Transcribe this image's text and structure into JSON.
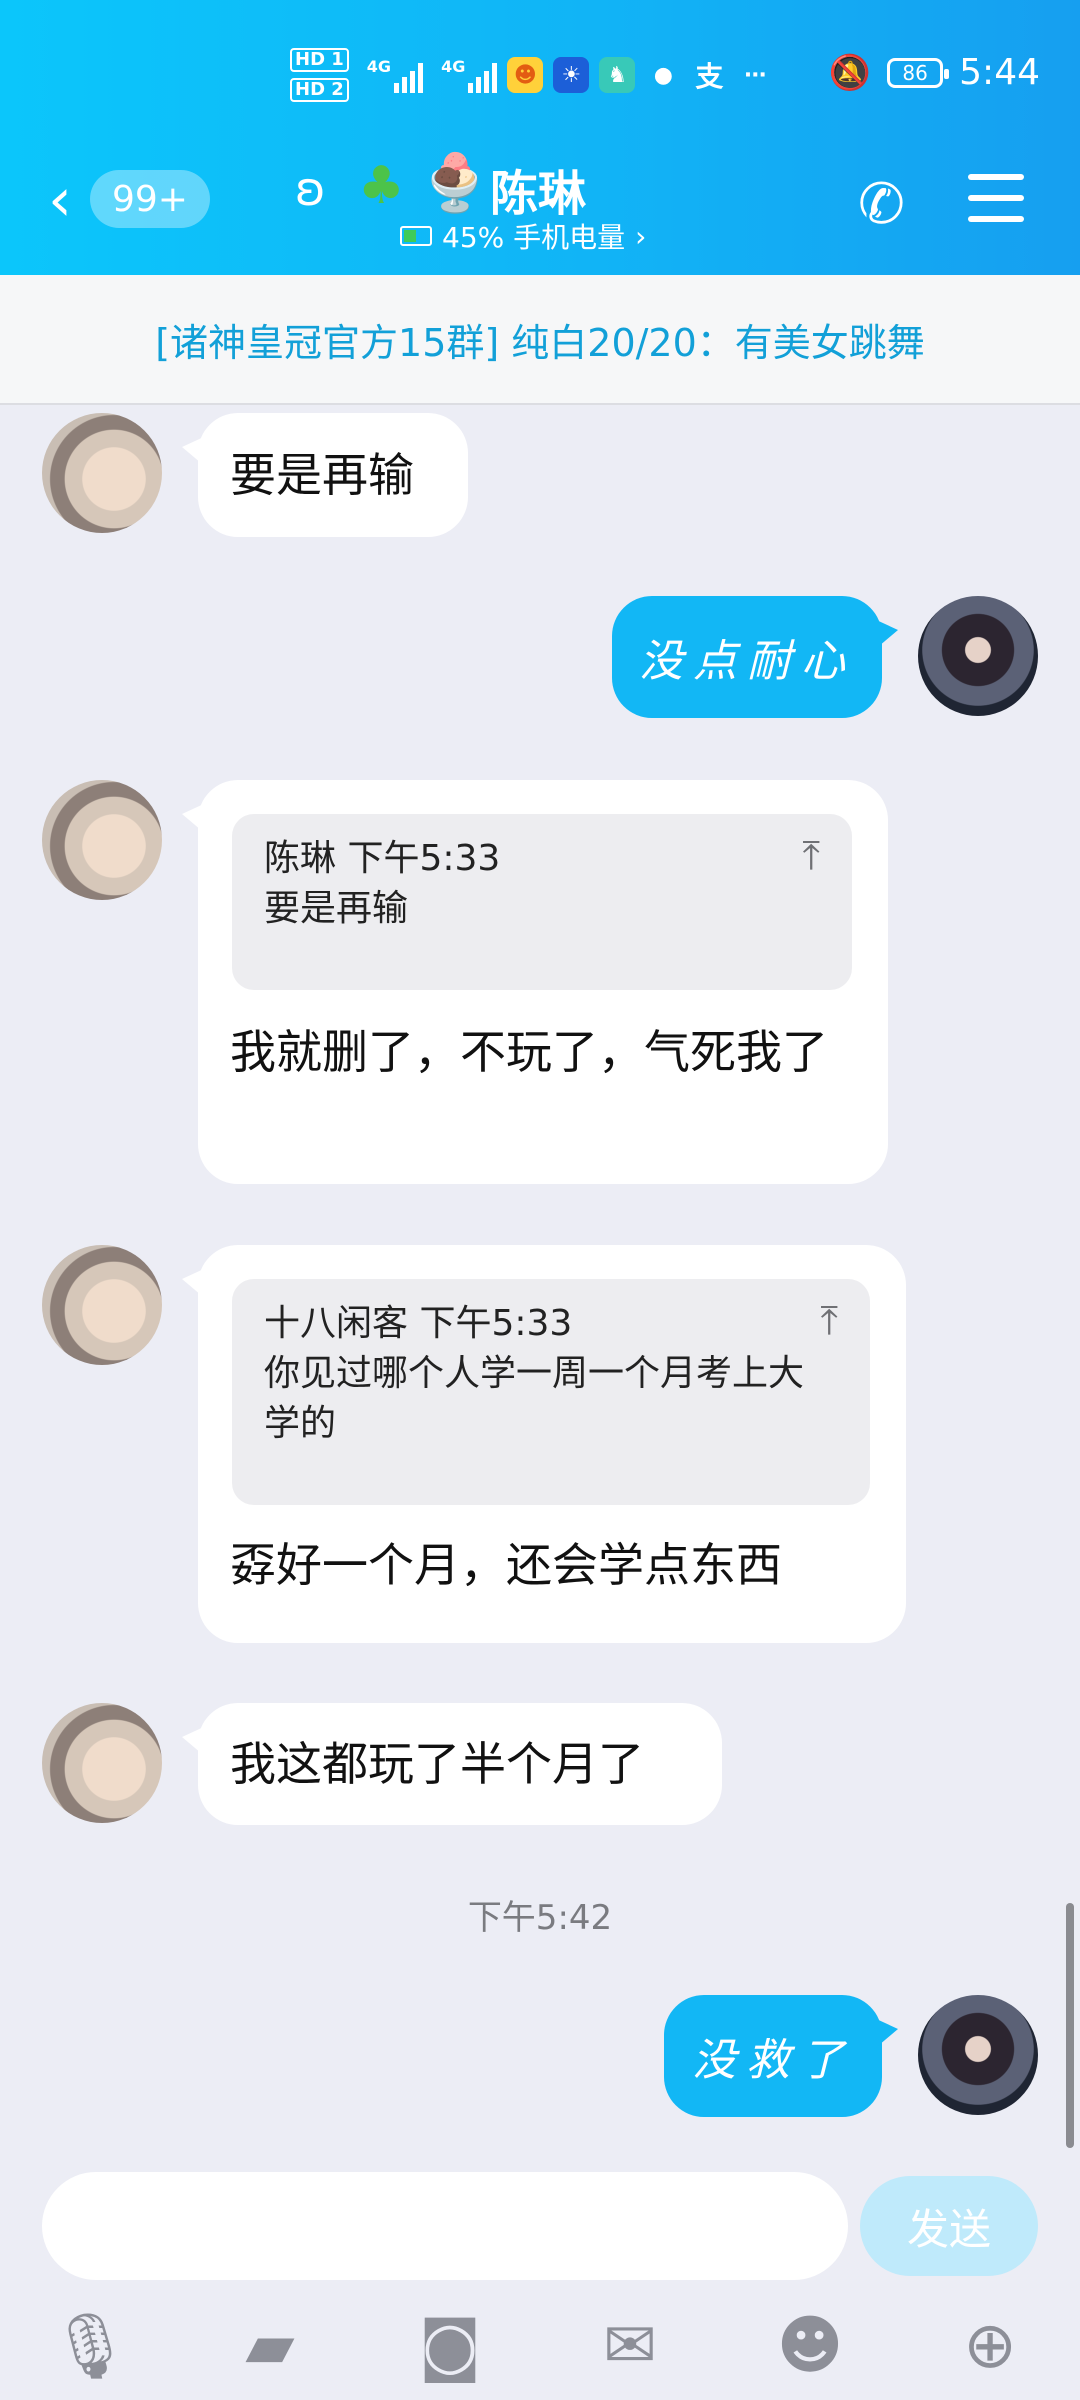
{
  "status_bar": {
    "hd1": "HD 1",
    "hd2": "HD 2",
    "net1": "4G",
    "net2": "4G",
    "battery": "86",
    "time": "5:44"
  },
  "nav": {
    "back_badge": "99+",
    "contact_name": "陈琳",
    "battery_text": "45% 手机电量",
    "chevron": "›"
  },
  "notice": {
    "text": "[诸神皇冠官方15群] 纯白20/20：有美女跳舞"
  },
  "messages": [
    {
      "side": "left",
      "text": "要是再输"
    },
    {
      "side": "right",
      "text": "没点耐心"
    },
    {
      "side": "left",
      "quote_author": "陈琳 下午5:33",
      "quote_text": "要是再输",
      "text": "我就删了，不玩了，气死我了"
    },
    {
      "side": "left",
      "quote_author": "十八闲客 下午5:33",
      "quote_text": "你见过哪个人学一周一个月考上大学的",
      "text": "孬好一个月，还会学点东西"
    },
    {
      "side": "left",
      "text": "我这都玩了半个月了"
    },
    {
      "side": "right",
      "text": "没救了"
    }
  ],
  "timestamp": "下午5:42",
  "composer": {
    "placeholder": "",
    "send_label": "发送"
  },
  "icons": [
    "mic-icon",
    "image-icon",
    "camera-icon",
    "red-packet-icon",
    "emoji-icon",
    "plus-icon"
  ],
  "colors": {
    "header_gradient_start": "#0bc6fb",
    "header_gradient_end": "#169ff0",
    "bubble_blue": "#12b7f5",
    "notice_text": "#12a0d8",
    "chat_bg": "#ecedf5"
  }
}
